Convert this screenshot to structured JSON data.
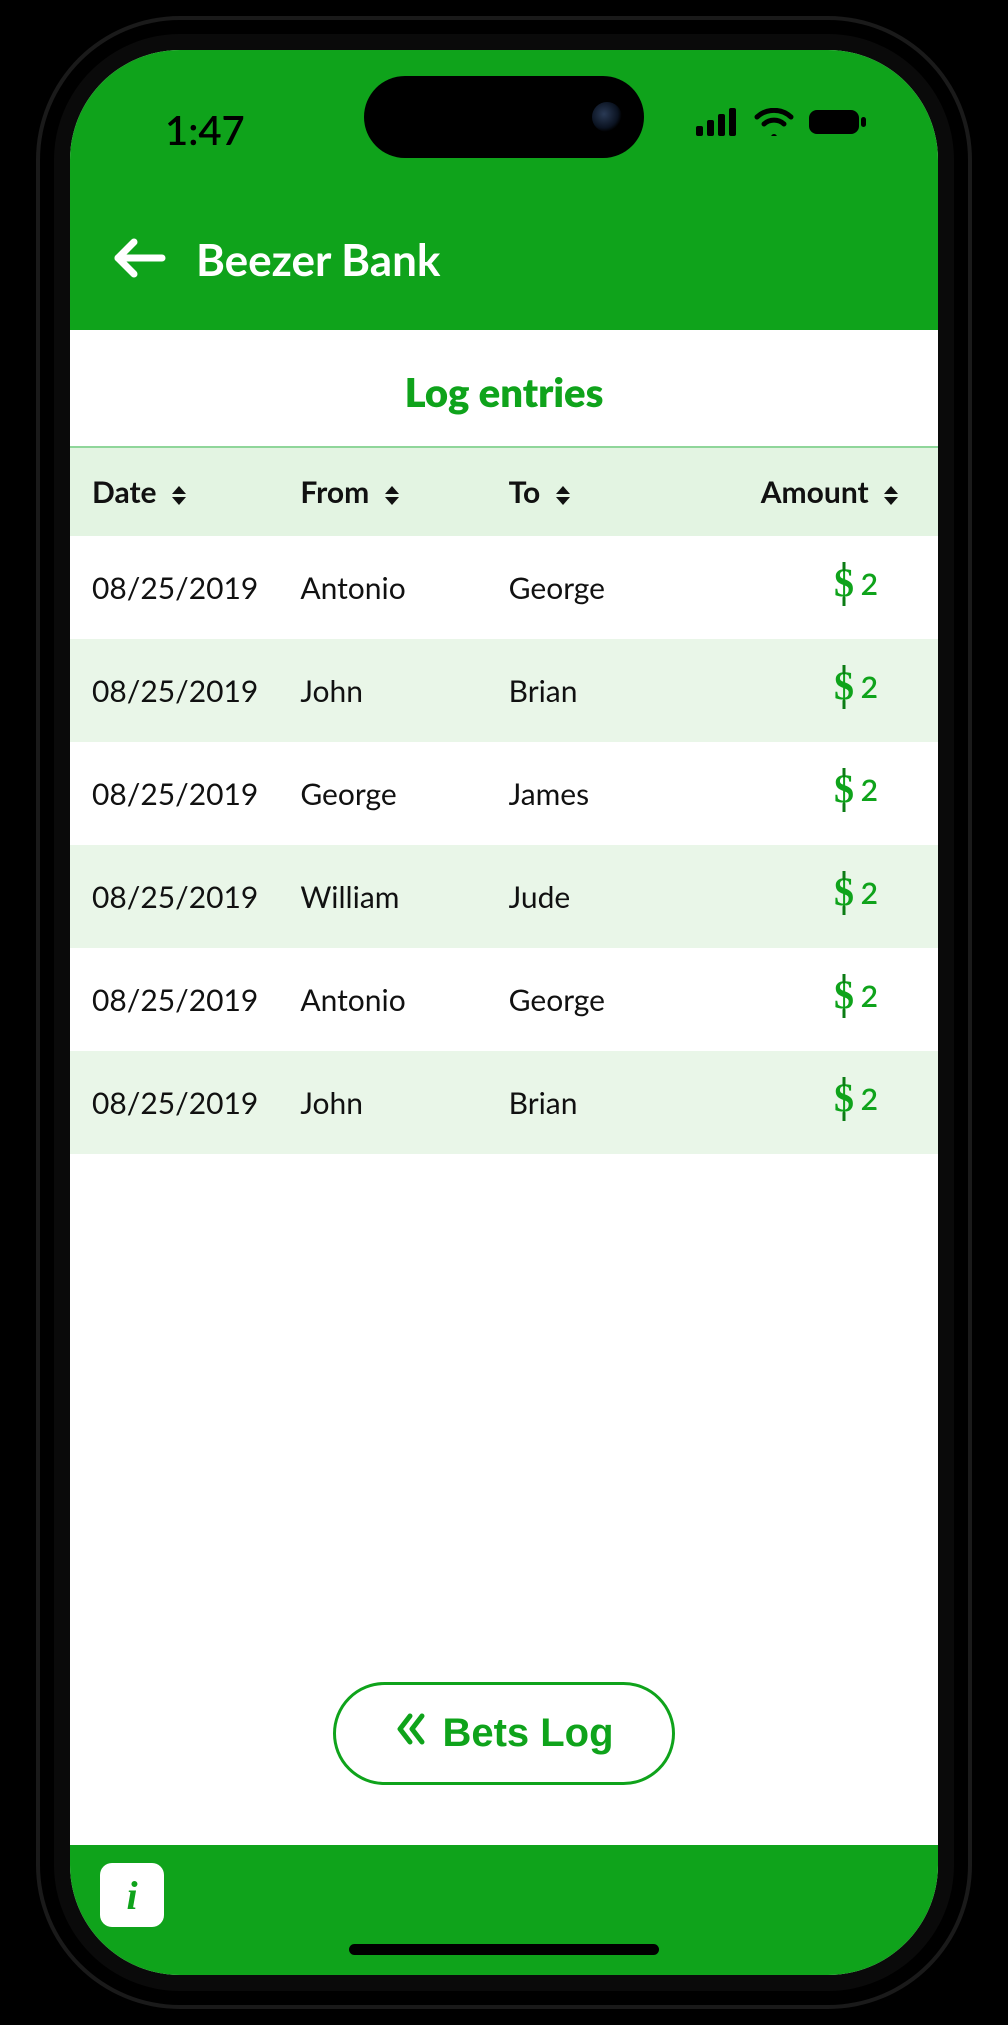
{
  "status": {
    "time": "1:47"
  },
  "header": {
    "title": "Beezer Bank"
  },
  "section": {
    "title": "Log entries"
  },
  "table": {
    "columns": {
      "date": "Date",
      "from": "From",
      "to": "To",
      "amount": "Amount"
    },
    "rows": [
      {
        "date": "08/25/2019",
        "from": "Antonio",
        "to": "George",
        "amount": "2"
      },
      {
        "date": "08/25/2019",
        "from": "John",
        "to": "Brian",
        "amount": "2"
      },
      {
        "date": "08/25/2019",
        "from": "George",
        "to": "James",
        "amount": "2"
      },
      {
        "date": "08/25/2019",
        "from": "William",
        "to": "Jude",
        "amount": "2"
      },
      {
        "date": "08/25/2019",
        "from": "Antonio",
        "to": "George",
        "amount": "2"
      },
      {
        "date": "08/25/2019",
        "from": "John",
        "to": "Brian",
        "amount": "2"
      }
    ]
  },
  "footer": {
    "bets_log_label": "Bets Log"
  },
  "info": {
    "label": "i"
  },
  "colors": {
    "accent": "#0fa31b",
    "row_alt": "#e9f6e8",
    "header_row": "#e3f4e2"
  }
}
